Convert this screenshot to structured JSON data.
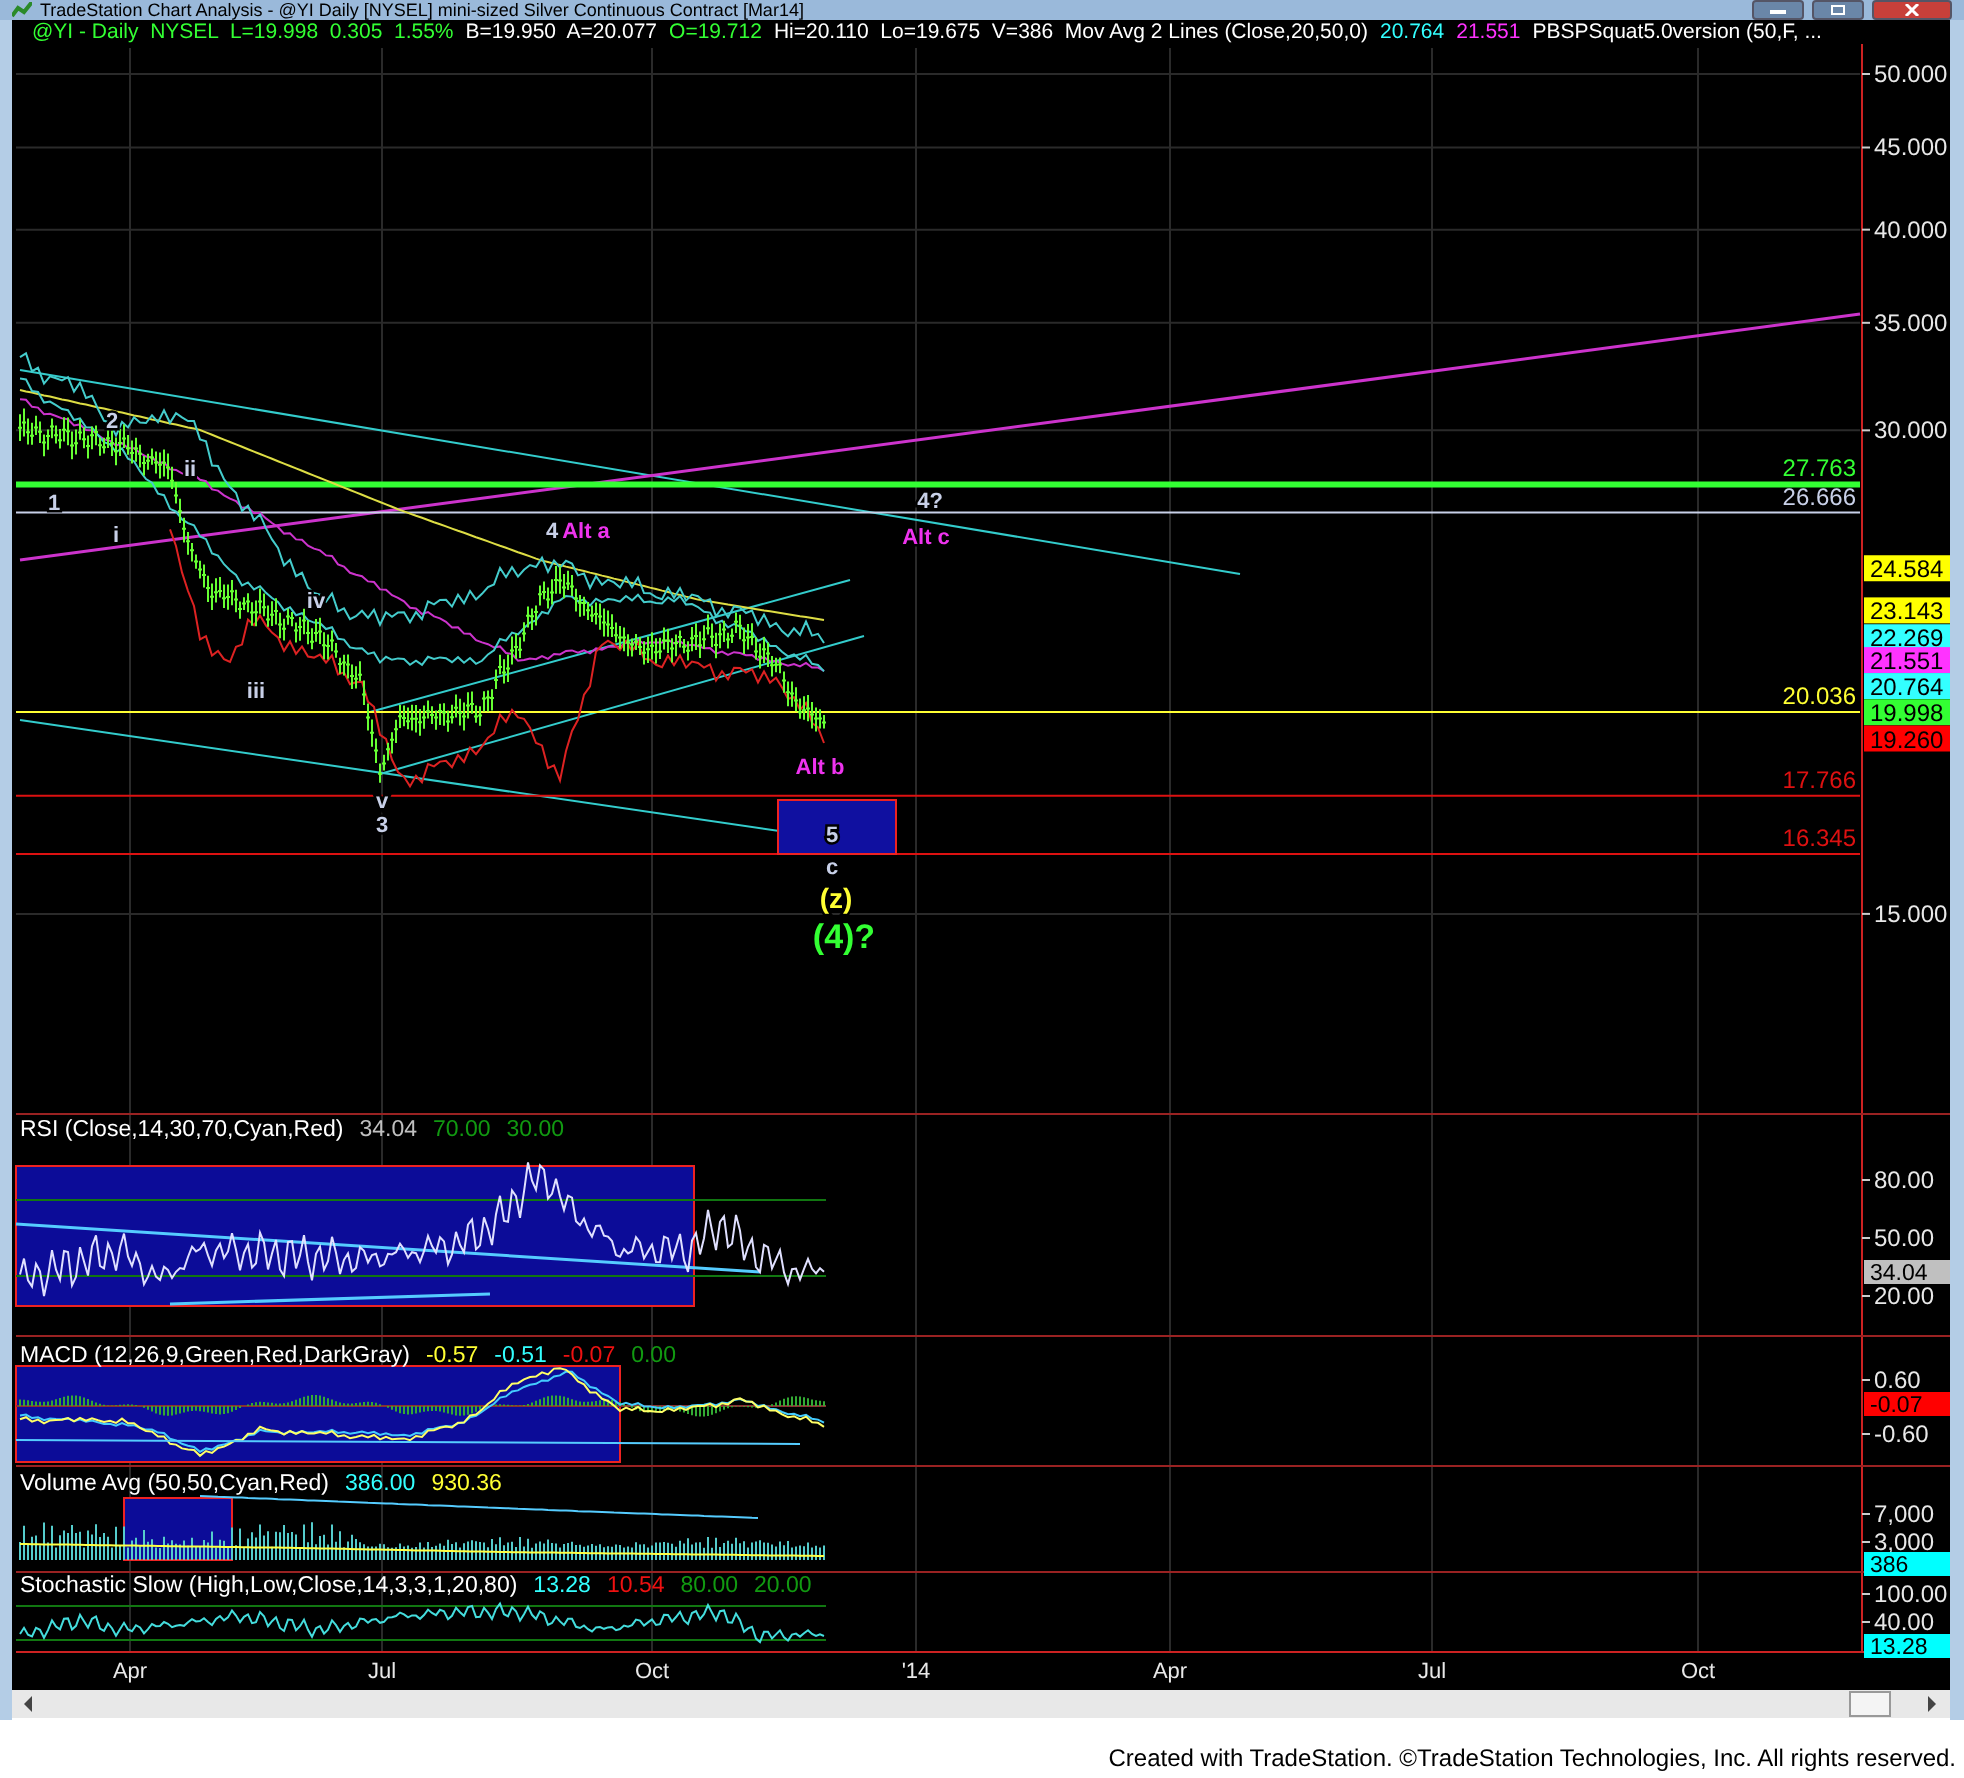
{
  "window": {
    "title": "TradeStation Chart Analysis - @YI Daily [NYSEL] mini-sized Silver Continuous Contract [Mar14]"
  },
  "header": [
    {
      "text": "@YI - Daily  NYSEL  L=19.998  0.305  1.55%",
      "color": "#33ff33"
    },
    {
      "text": "B=19.950  A=20.077",
      "color": "#ffffff"
    },
    {
      "text": "O=19.712",
      "color": "#33ff33"
    },
    {
      "text": "Hi=20.110  Lo=19.675  V=386  Mov Avg 2 Lines (Close,20,50,0)",
      "color": "#ffffff"
    },
    {
      "text": "20.764",
      "color": "#33ffff"
    },
    {
      "text": "21.551",
      "color": "#ff33ff"
    },
    {
      "text": "PBSPSquat5.0version (50,F, ...",
      "color": "#ffffff"
    }
  ],
  "price_panel": {
    "axis_ticks": [
      "50.000",
      "45.000",
      "40.000",
      "35.000",
      "30.000",
      "15.000"
    ],
    "level_lines": [
      {
        "label": "27.763",
        "color": "#33ff33"
      },
      {
        "label": "26.666",
        "color": "#c8d0e8"
      },
      {
        "label": "20.036",
        "color": "#ffff33"
      },
      {
        "label": "17.766",
        "color": "#dd1111"
      },
      {
        "label": "16.345",
        "color": "#dd1111"
      }
    ],
    "axis_badges": [
      {
        "label": "24.584",
        "color": "#ffff00"
      },
      {
        "label": "23.143",
        "color": "#ffff00"
      },
      {
        "label": "22.269",
        "color": "#33ffff"
      },
      {
        "label": "21.551",
        "color": "#ff33ff"
      },
      {
        "label": "20.764",
        "color": "#33ffff"
      },
      {
        "label": "19.998",
        "color": "#33ff33"
      },
      {
        "label": "19.260",
        "color": "#ff0000"
      }
    ],
    "wave_labels": [
      {
        "text": "1",
        "color": "#c8d0e8"
      },
      {
        "text": "2",
        "color": "#c8d0e8"
      },
      {
        "text": "i",
        "color": "#c8d0e8"
      },
      {
        "text": "ii",
        "color": "#c8d0e8"
      },
      {
        "text": "iii",
        "color": "#c8d0e8"
      },
      {
        "text": "iv",
        "color": "#c8d0e8"
      },
      {
        "text": "v",
        "color": "#c8d0e8"
      },
      {
        "text": "3",
        "color": "#c8d0e8"
      },
      {
        "text": "4",
        "color": "#c8d0e8"
      },
      {
        "text": "Alt a",
        "color": "#ee33ee"
      },
      {
        "text": "4?",
        "color": "#c8d0e8"
      },
      {
        "text": "Alt c",
        "color": "#ee33ee"
      },
      {
        "text": "Alt b",
        "color": "#ee33ee"
      },
      {
        "text": "5",
        "color": "#c8d0e8"
      },
      {
        "text": "c",
        "color": "#c8d0e8"
      },
      {
        "text": "(z)",
        "color": "#ffff33"
      },
      {
        "text": "(4)?",
        "color": "#33ff33"
      }
    ]
  },
  "indicators": [
    {
      "kind": "rsi",
      "legend": [
        {
          "text": "RSI (Close,14,30,70,Cyan,Red)",
          "color": "#ffffff"
        },
        {
          "text": "34.04",
          "color": "#c0c0c0"
        },
        {
          "text": "70.00",
          "color": "#119911"
        },
        {
          "text": "30.00",
          "color": "#119911"
        }
      ],
      "axis_ticks": [
        "80.00",
        "50.00",
        "20.00"
      ],
      "badge": {
        "label": "34.04",
        "color": "#c0c0c0"
      }
    },
    {
      "kind": "macd",
      "legend": [
        {
          "text": "MACD (12,26,9,Green,Red,DarkGray)",
          "color": "#ffffff"
        },
        {
          "text": "-0.57",
          "color": "#ffff33"
        },
        {
          "text": "-0.51",
          "color": "#33ffff"
        },
        {
          "text": "-0.07",
          "color": "#ee1111"
        },
        {
          "text": "0.00",
          "color": "#119911"
        }
      ],
      "axis_ticks": [
        "0.60",
        "-0.60"
      ],
      "badge": {
        "label": "-0.07",
        "color": "#ff0000"
      }
    },
    {
      "kind": "volume",
      "legend": [
        {
          "text": "Volume Avg (50,50,Cyan,Red)",
          "color": "#ffffff"
        },
        {
          "text": "386.00",
          "color": "#33ffff"
        },
        {
          "text": "930.36",
          "color": "#ffff33"
        }
      ],
      "axis_ticks": [
        "7,000",
        "3,000"
      ],
      "badge": {
        "label": "386",
        "color": "#00ffff"
      }
    },
    {
      "kind": "stochastic",
      "legend": [
        {
          "text": "Stochastic Slow (High,Low,Close,14,3,3,1,20,80)",
          "color": "#ffffff"
        },
        {
          "text": "13.28",
          "color": "#33ffff"
        },
        {
          "text": "10.54",
          "color": "#ee1111"
        },
        {
          "text": "80.00",
          "color": "#119911"
        },
        {
          "text": "20.00",
          "color": "#119911"
        }
      ],
      "axis_ticks": [
        "100.00",
        "40.00"
      ],
      "badge": {
        "label": "13.28",
        "color": "#00ffff"
      }
    }
  ],
  "date_axis": [
    "Apr",
    "Jul",
    "Oct",
    "'14",
    "Apr",
    "Jul",
    "Oct"
  ],
  "footer": "Created with TradeStation. ©TradeStation Technologies, Inc. All rights reserved."
}
